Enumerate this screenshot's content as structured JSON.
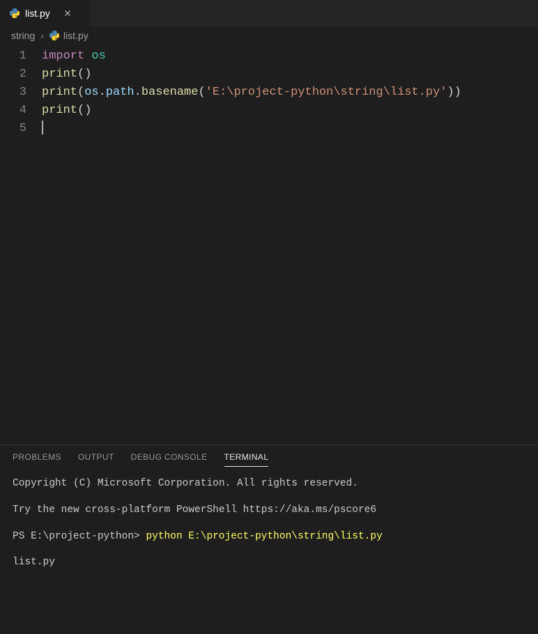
{
  "tab": {
    "title": "list.py",
    "icon": "python-icon"
  },
  "breadcrumbs": {
    "items": [
      {
        "label": "string",
        "icon": null
      },
      {
        "label": "list.py",
        "icon": "python-icon"
      }
    ]
  },
  "editor": {
    "lines": [
      {
        "num": "1",
        "tokens": [
          {
            "t": "import",
            "c": "tok-keyword"
          },
          {
            "t": " ",
            "c": ""
          },
          {
            "t": "os",
            "c": "tok-module"
          }
        ]
      },
      {
        "num": "2",
        "tokens": [
          {
            "t": "print",
            "c": "tok-func"
          },
          {
            "t": "()",
            "c": "tok-punct"
          }
        ]
      },
      {
        "num": "3",
        "tokens": [
          {
            "t": "print",
            "c": "tok-func"
          },
          {
            "t": "(",
            "c": "tok-punct"
          },
          {
            "t": "os",
            "c": "tok-obj"
          },
          {
            "t": ".",
            "c": "tok-punct"
          },
          {
            "t": "path",
            "c": "tok-obj"
          },
          {
            "t": ".",
            "c": "tok-punct"
          },
          {
            "t": "basename",
            "c": "tok-method"
          },
          {
            "t": "(",
            "c": "tok-punct"
          },
          {
            "t": "'E:\\project-python\\string\\list.py'",
            "c": "tok-string"
          },
          {
            "t": "))",
            "c": "tok-punct"
          }
        ]
      },
      {
        "num": "4",
        "tokens": [
          {
            "t": "print",
            "c": "tok-func"
          },
          {
            "t": "()",
            "c": "tok-punct"
          }
        ]
      },
      {
        "num": "5",
        "tokens": []
      }
    ]
  },
  "panel": {
    "tabs": {
      "problems": "PROBLEMS",
      "output": "OUTPUT",
      "debug": "DEBUG CONSOLE",
      "terminal": "TERMINAL"
    },
    "active_tab": "terminal",
    "terminal": {
      "line1": "Copyright (C) Microsoft Corporation. All rights reserved.",
      "line2": "Try the new cross-platform PowerShell https://aka.ms/pscore6",
      "prompt": "PS E:\\project-python> ",
      "command": "python E:\\project-python\\string\\list.py",
      "output": "list.py"
    }
  }
}
